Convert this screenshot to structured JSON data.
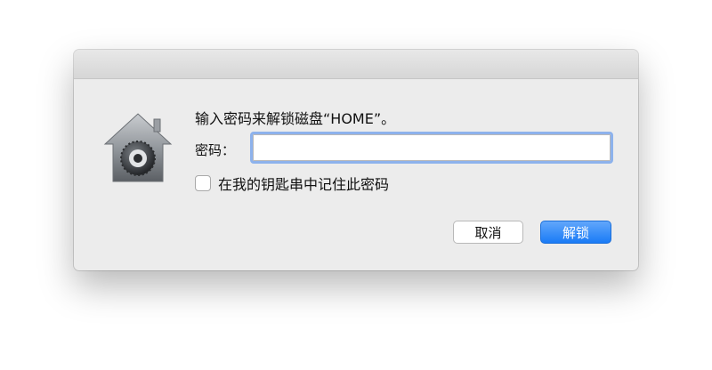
{
  "dialog": {
    "message": "输入密码来解锁磁盘“HOME”。",
    "password_label": "密码：",
    "password_value": "",
    "remember_label": "在我的钥匙串中记住此密码",
    "remember_checked": false,
    "cancel_label": "取消",
    "unlock_label": "解锁",
    "icon": "lock-house-icon",
    "accent_color": "#1a7bf6",
    "focus_ring_color": "#8db2ec"
  }
}
